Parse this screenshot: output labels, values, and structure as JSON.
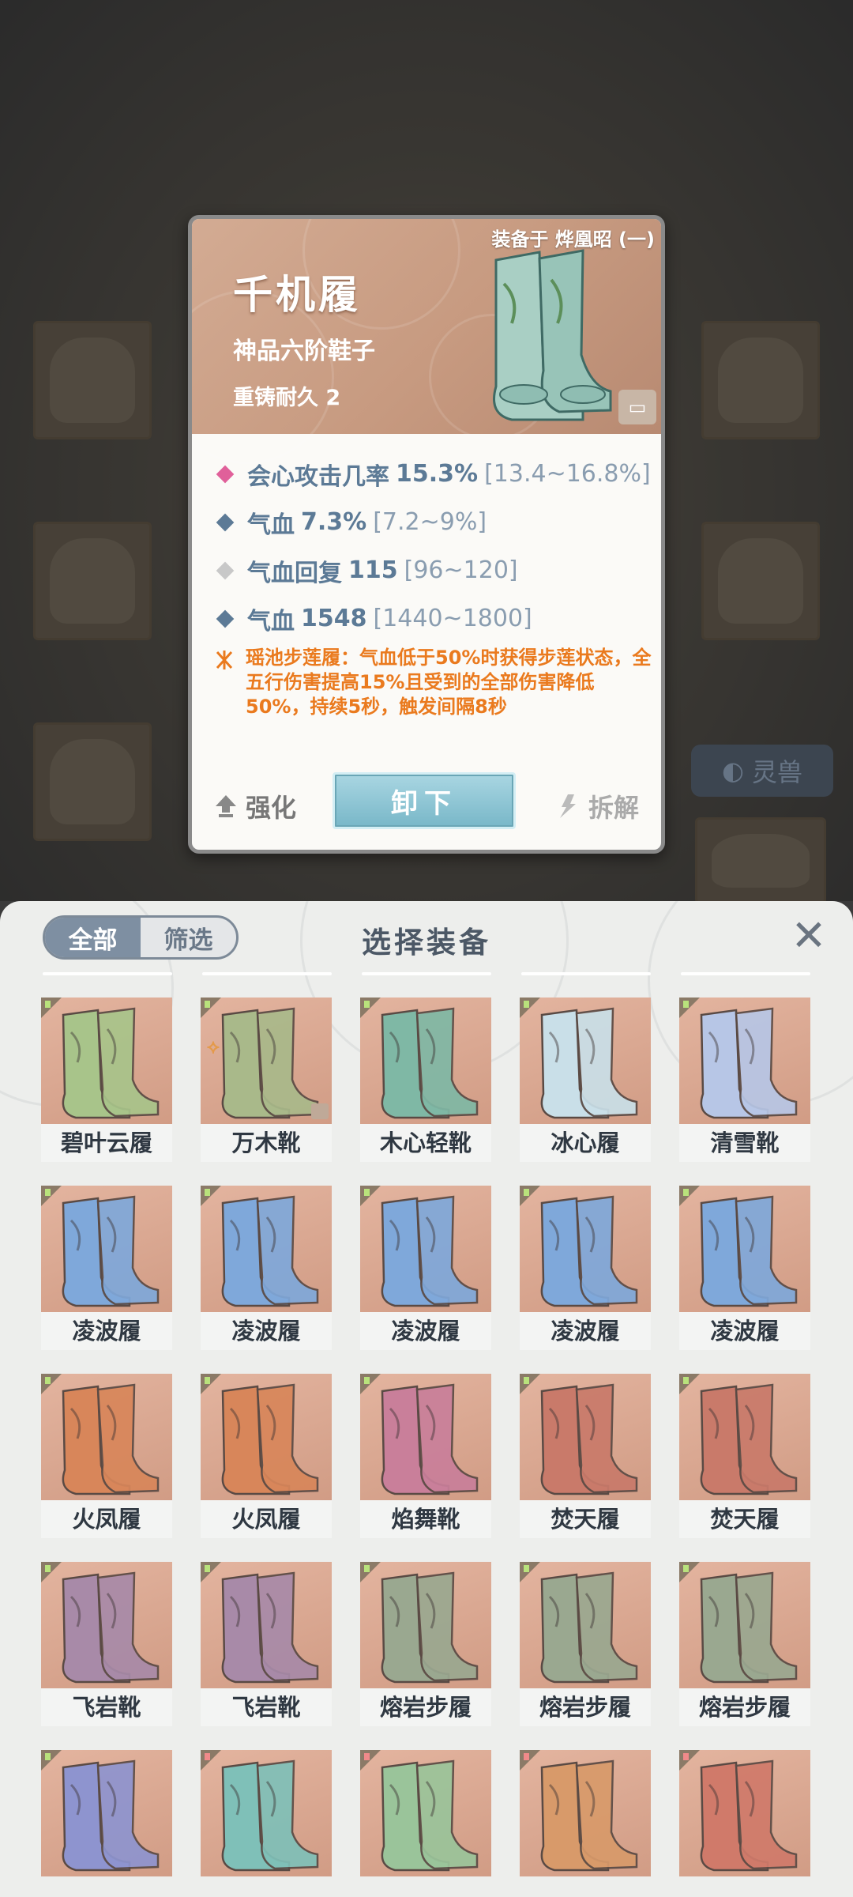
{
  "detail": {
    "equipped_on": "装备于 烨凰昭 (一)",
    "name": "千机履",
    "grade": "神品六阶鞋子",
    "durability": "重铸耐久 2",
    "stats": [
      {
        "name": "会心攻击几率",
        "value": "15.3%",
        "range": "[13.4~16.8%]",
        "color": "#e0609a"
      },
      {
        "name": "气血",
        "value": "7.3%",
        "range": "[7.2~9%]",
        "color": "#5c7a96"
      },
      {
        "name": "气血回复",
        "value": "115",
        "range": "[96~120]",
        "color": "#c8c8c8"
      },
      {
        "name": "气血",
        "value": "1548",
        "range": "[1440~1800]",
        "color": "#5c7a96"
      }
    ],
    "special_effect": "瑶池步莲履：气血低于50%时获得步莲状态，全五行伤害提高15%且受到的全部伤害降低50%，持续5秒，触发间隔8秒",
    "buttons": {
      "upgrade": "强化",
      "unequip": "卸下",
      "decompose": "拆解"
    }
  },
  "background": {
    "pet_button": "灵兽"
  },
  "panel": {
    "title": "选择装备",
    "tabs": {
      "all": "全部",
      "filter": "筛选"
    },
    "items": [
      {
        "name": "碧叶云履",
        "hue": "#a8c48a",
        "badge": "green"
      },
      {
        "name": "万木靴",
        "hue": "#a9b98a",
        "badge": "green",
        "set": true,
        "locked": true
      },
      {
        "name": "木心轻靴",
        "hue": "#7fb8a5",
        "badge": "green"
      },
      {
        "name": "冰心履",
        "hue": "#c9dfe8",
        "badge": "green"
      },
      {
        "name": "清雪靴",
        "hue": "#b7c6e6",
        "badge": "green"
      },
      {
        "name": "凌波履",
        "hue": "#7fa8da",
        "badge": "green"
      },
      {
        "name": "凌波履",
        "hue": "#7fa8da",
        "badge": "green"
      },
      {
        "name": "凌波履",
        "hue": "#7fa8da",
        "badge": "green"
      },
      {
        "name": "凌波履",
        "hue": "#7fa8da",
        "badge": "green"
      },
      {
        "name": "凌波履",
        "hue": "#7fa8da",
        "badge": "green"
      },
      {
        "name": "火凤履",
        "hue": "#d8865a",
        "badge": "green"
      },
      {
        "name": "火凤履",
        "hue": "#d8865a",
        "badge": "green"
      },
      {
        "name": "焰舞靴",
        "hue": "#c97f9a",
        "badge": "green"
      },
      {
        "name": "焚天履",
        "hue": "#c97a6a",
        "badge": "green"
      },
      {
        "name": "焚天履",
        "hue": "#c97a6a",
        "badge": "green"
      },
      {
        "name": "飞岩靴",
        "hue": "#a88aa8",
        "badge": "green"
      },
      {
        "name": "飞岩靴",
        "hue": "#a88aa8",
        "badge": "green"
      },
      {
        "name": "熔岩步履",
        "hue": "#9aa890",
        "badge": "green"
      },
      {
        "name": "熔岩步履",
        "hue": "#9aa890",
        "badge": "green"
      },
      {
        "name": "熔岩步履",
        "hue": "#9aa890",
        "badge": "green"
      },
      {
        "name": "",
        "hue": "#8e94cf",
        "badge": "green"
      },
      {
        "name": "",
        "hue": "#7fc0b8",
        "badge": "pink"
      },
      {
        "name": "",
        "hue": "#9ac49a",
        "badge": "pink"
      },
      {
        "name": "",
        "hue": "#d89a6a",
        "badge": "pink"
      },
      {
        "name": "",
        "hue": "#d07a6a",
        "badge": "pink"
      }
    ]
  }
}
